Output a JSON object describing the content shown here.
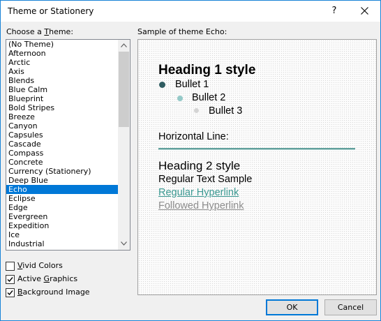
{
  "window": {
    "title": "Theme or Stationery",
    "help_glyph": "?",
    "close_icon": "close-icon"
  },
  "theme_list": {
    "label_prefix": "Choose a ",
    "label_accel": "T",
    "label_suffix": "heme:",
    "items": [
      "(No Theme)",
      "Afternoon",
      "Arctic",
      "Axis",
      "Blends",
      "Blue Calm",
      "Blueprint",
      "Bold Stripes",
      "Breeze",
      "Canyon",
      "Capsules",
      "Cascade",
      "Compass",
      "Concrete",
      "Currency (Stationery)",
      "Deep Blue",
      "Echo",
      "Eclipse",
      "Edge",
      "Evergreen",
      "Expedition",
      "Ice",
      "Industrial"
    ],
    "selected": "Echo"
  },
  "options": {
    "vivid_accel": "V",
    "vivid_rest": "ivid Colors",
    "vivid_checked": false,
    "active_pre": "Active ",
    "active_accel": "G",
    "active_rest": "raphics",
    "active_checked": true,
    "bg_accel": "B",
    "bg_rest": "ackground Image",
    "bg_checked": true
  },
  "sample": {
    "label": "Sample of theme Echo:",
    "heading1": "Heading 1 style",
    "bullet1": "Bullet 1",
    "bullet2": "Bullet 2",
    "bullet3": "Bullet 3",
    "horizontal_line": "Horizontal Line:",
    "heading2": "Heading 2 style",
    "regular_text": "Regular Text Sample",
    "hyperlink": "Regular Hyperlink",
    "followed_hyperlink": "Followed Hyperlink",
    "colors": {
      "link": "#3a9891",
      "followed": "#8d8d8d",
      "bullet1": "#2f5c61",
      "bullet2": "#94c9c8",
      "bullet3": "#d4d4d4",
      "rule": "#5f9f9b"
    }
  },
  "buttons": {
    "ok": "OK",
    "cancel": "Cancel"
  }
}
